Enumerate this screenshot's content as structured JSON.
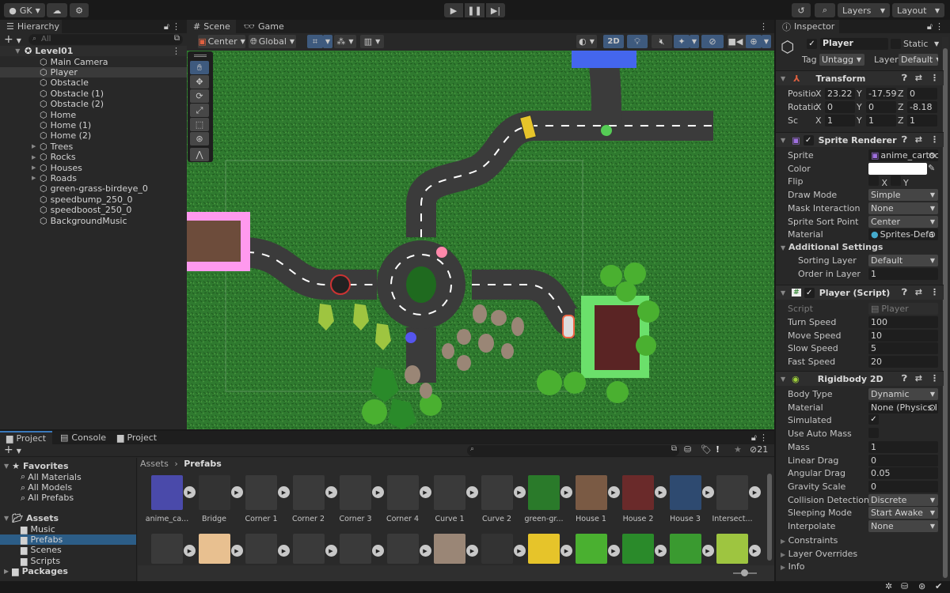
{
  "topbar": {
    "account": "GK",
    "layers": "Layers",
    "layout": "Layout"
  },
  "hierarchy": {
    "tab": "Hierarchy",
    "search_placeholder": "All",
    "root": "Level01",
    "items": [
      {
        "label": "Main Camera",
        "expandable": false
      },
      {
        "label": "Player",
        "expandable": false,
        "selected": true
      },
      {
        "label": "Obstacle",
        "expandable": false
      },
      {
        "label": "Obstacle (1)",
        "expandable": false
      },
      {
        "label": "Obstacle (2)",
        "expandable": false
      },
      {
        "label": "Home",
        "expandable": false
      },
      {
        "label": "Home (1)",
        "expandable": false
      },
      {
        "label": "Home (2)",
        "expandable": false
      },
      {
        "label": "Trees",
        "expandable": true
      },
      {
        "label": "Rocks",
        "expandable": true
      },
      {
        "label": "Houses",
        "expandable": true
      },
      {
        "label": "Roads",
        "expandable": true
      },
      {
        "label": "green-grass-birdeye_0",
        "expandable": false
      },
      {
        "label": "speedbump_250_0",
        "expandable": false
      },
      {
        "label": "speedboost_250_0",
        "expandable": false
      },
      {
        "label": "BackgroundMusic",
        "expandable": false
      }
    ]
  },
  "scene": {
    "tabs": [
      "Scene",
      "Game"
    ],
    "pivot": "Center",
    "space": "Global",
    "mode_2d": "2D"
  },
  "inspector": {
    "tab": "Inspector",
    "object_name": "Player",
    "static_label": "Static",
    "tag_label": "Tag",
    "tag_value": "Untagged",
    "layer_label": "Layer",
    "layer_value": "Default",
    "transform": {
      "title": "Transform",
      "position_label": "Positio",
      "rotation_label": "Rotatic",
      "scale_label": "Sc",
      "position": {
        "x": "23.22",
        "y": "-17.59",
        "z": "0"
      },
      "rotation": {
        "x": "0",
        "y": "0",
        "z": "-8.18"
      },
      "scale": {
        "x": "1",
        "y": "1",
        "z": "1"
      }
    },
    "sprite_renderer": {
      "title": "Sprite Renderer",
      "fields": [
        {
          "label": "Sprite",
          "value": "anime_cartoo",
          "kind": "object"
        },
        {
          "label": "Color",
          "value": "",
          "kind": "color"
        },
        {
          "label": "Flip",
          "value": "X  Y",
          "kind": "flip"
        },
        {
          "label": "Draw Mode",
          "value": "Simple",
          "kind": "dropdown"
        },
        {
          "label": "Mask Interaction",
          "value": "None",
          "kind": "dropdown"
        },
        {
          "label": "Sprite Sort Point",
          "value": "Center",
          "kind": "dropdown"
        },
        {
          "label": "Material",
          "value": "Sprites-Defa",
          "kind": "object"
        }
      ],
      "additional_settings": "Additional Settings",
      "sorting_layer_label": "Sorting Layer",
      "sorting_layer": "Default",
      "order_label": "Order in Layer",
      "order": "1"
    },
    "player_script": {
      "title": "Player (Script)",
      "script_label": "Script",
      "script_value": "Player",
      "fields": [
        {
          "label": "Turn Speed",
          "value": "100"
        },
        {
          "label": "Move Speed",
          "value": "10"
        },
        {
          "label": "Slow Speed",
          "value": "5"
        },
        {
          "label": "Fast Speed",
          "value": "20"
        }
      ]
    },
    "rigidbody": {
      "title": "Rigidbody 2D",
      "fields": [
        {
          "label": "Body Type",
          "value": "Dynamic",
          "kind": "dropdown"
        },
        {
          "label": "Material",
          "value": "None (Physics I",
          "kind": "object"
        },
        {
          "label": "Simulated",
          "value": "✓",
          "kind": "check"
        },
        {
          "label": "Use Auto Mass",
          "value": "",
          "kind": "check"
        },
        {
          "label": "Mass",
          "value": "1",
          "kind": "text"
        },
        {
          "label": "Linear Drag",
          "value": "0",
          "kind": "text"
        },
        {
          "label": "Angular Drag",
          "value": "0.05",
          "kind": "text"
        },
        {
          "label": "Gravity Scale",
          "value": "0",
          "kind": "text"
        },
        {
          "label": "Collision Detection",
          "value": "Discrete",
          "kind": "dropdown"
        },
        {
          "label": "Sleeping Mode",
          "value": "Start Awake",
          "kind": "dropdown"
        },
        {
          "label": "Interpolate",
          "value": "None",
          "kind": "dropdown"
        }
      ],
      "foldouts": [
        "Constraints",
        "Layer Overrides",
        "Info"
      ]
    }
  },
  "project": {
    "tabs": [
      "Project",
      "Console",
      "Project"
    ],
    "favorites": "Favorites",
    "favorite_items": [
      "All Materials",
      "All Models",
      "All Prefabs"
    ],
    "assets": "Assets",
    "asset_folders": [
      "Music",
      "Prefabs",
      "Scenes",
      "Scripts"
    ],
    "packages": "Packages",
    "breadcrumb": [
      "Assets",
      "Prefabs"
    ],
    "hidden_count": "21",
    "row1": [
      "anime_ca...",
      "Bridge",
      "Corner 1",
      "Corner 2",
      "Corner 3",
      "Corner 4",
      "Curve 1",
      "Curve 2",
      "green-gr...",
      "House 1",
      "House 2",
      "House 3",
      "Intersect..."
    ]
  }
}
